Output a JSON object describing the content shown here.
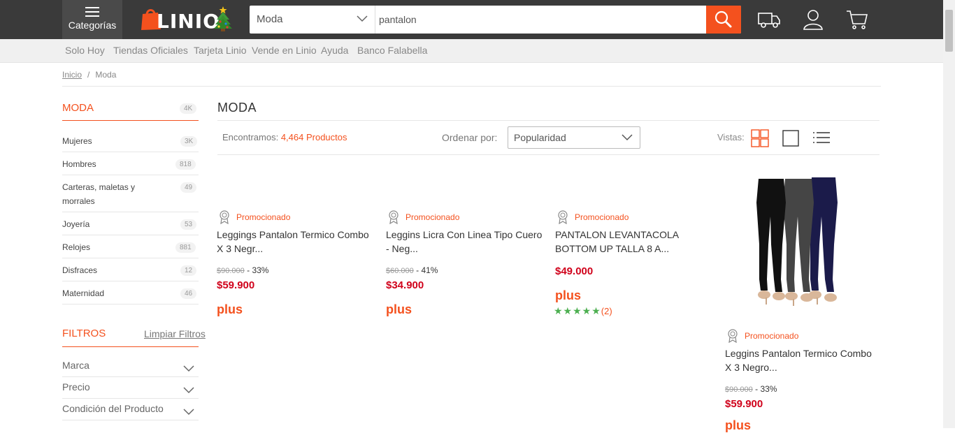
{
  "header": {
    "categories_label": "Categorías",
    "logo_text": "LINIO",
    "search_category": "Moda",
    "search_value": "pantalon"
  },
  "subnav": [
    "Solo Hoy",
    "Tiendas Oficiales",
    "Tarjeta Linio",
    "Vende en Linio",
    "Ayuda",
    "Banco Falabella"
  ],
  "breadcrumb": {
    "home": "Inicio",
    "sep": "/",
    "current": "Moda"
  },
  "sidebar": {
    "title": "MODA",
    "title_count": "4K",
    "items": [
      {
        "label": "Mujeres",
        "count": "3K"
      },
      {
        "label": "Hombres",
        "count": "818"
      },
      {
        "label": "Carteras, maletas y morrales",
        "count": "49"
      },
      {
        "label": "Joyería",
        "count": "53"
      },
      {
        "label": "Relojes",
        "count": "881"
      },
      {
        "label": "Disfraces",
        "count": "12"
      },
      {
        "label": "Maternidad",
        "count": "46"
      }
    ],
    "filters_title": "FILTROS",
    "clear_filters": "Limpiar Filtros",
    "filters": [
      "Marca",
      "Precio",
      "Condición del Producto"
    ]
  },
  "main": {
    "title": "MODA",
    "found_prefix": "Encontramos:",
    "found_count": "4,464 Productos",
    "order_label": "Ordenar por:",
    "order_value": "Popularidad",
    "views_label": "Vistas:"
  },
  "products": [
    {
      "promo": "Promocionado",
      "name": "Leggings Pantalon Termico Combo X 3 Negr...",
      "old_price": "$90.000",
      "discount": "- 33%",
      "price": "$59.900",
      "plus": "plus"
    },
    {
      "promo": "Promocionado",
      "name": "Leggins Licra Con Linea Tipo Cuero - Neg...",
      "old_price": "$60.000",
      "discount": "- 41%",
      "price": "$34.900",
      "plus": "plus"
    },
    {
      "promo": "Promocionado",
      "name": "PANTALON LEVANTACOLA BOTTOM UP TALLA 8 A...",
      "price": "$49.000",
      "plus": "plus",
      "stars": "★★★★★",
      "reviews": "(2)"
    },
    {
      "promo": "Promocionado",
      "name": "Leggins Pantalon Termico Combo X 3 Negro...",
      "old_price": "$90.000",
      "discount": "- 33%",
      "price": "$59.900",
      "plus": "plus"
    }
  ],
  "colors": {
    "accent": "#f4511e",
    "header": "#3a3a3a",
    "price": "#d0021b",
    "stars": "#4caf50"
  }
}
